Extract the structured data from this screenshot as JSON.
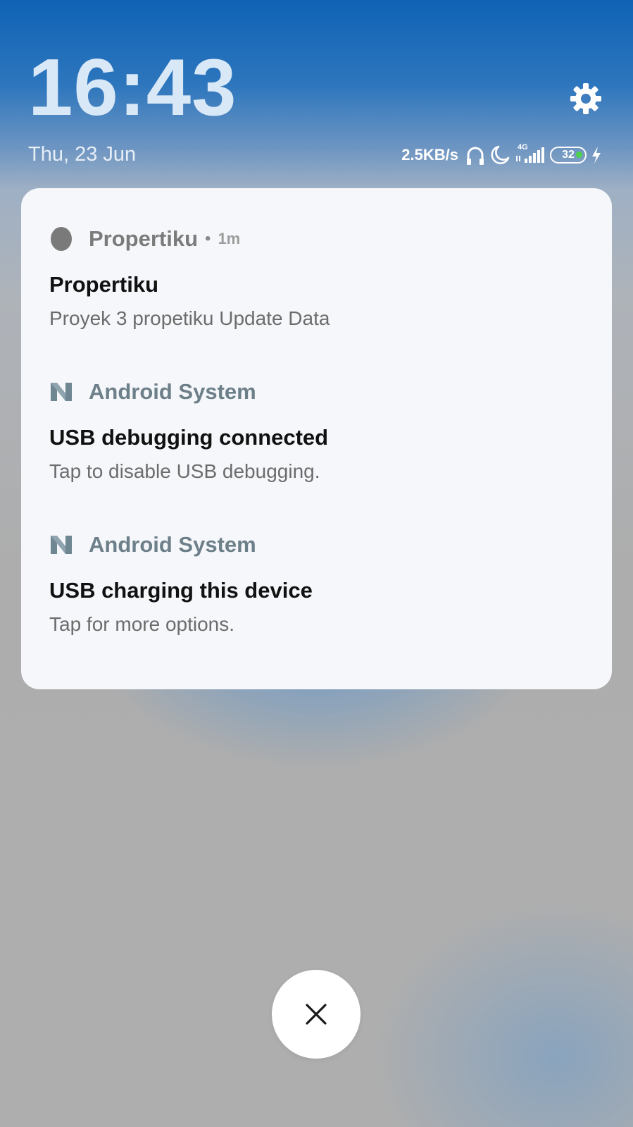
{
  "lockscreen": {
    "time": "16:43",
    "date": "Thu, 23 Jun"
  },
  "status_bar": {
    "net_speed": "2.5KB/s",
    "network_type": "4G",
    "battery_level": "32",
    "icons": [
      "headphones-icon",
      "moon-icon",
      "signal-icon",
      "battery-icon",
      "charging-icon"
    ]
  },
  "notifications": [
    {
      "app_name": "Propertiku",
      "time": "1m",
      "title": "Propertiku",
      "body": "Proyek 3 propetiku Update Data"
    },
    {
      "app_name": "Android System",
      "title": "USB debugging connected",
      "body": "Tap to disable USB debugging."
    },
    {
      "app_name": "Android System",
      "title": "USB charging this device",
      "body": "Tap for more options."
    }
  ],
  "colors": {
    "accent_app_name": "#6d7f89",
    "card_background": "#f5f7fa",
    "battery_charge": "#4bd34b"
  }
}
